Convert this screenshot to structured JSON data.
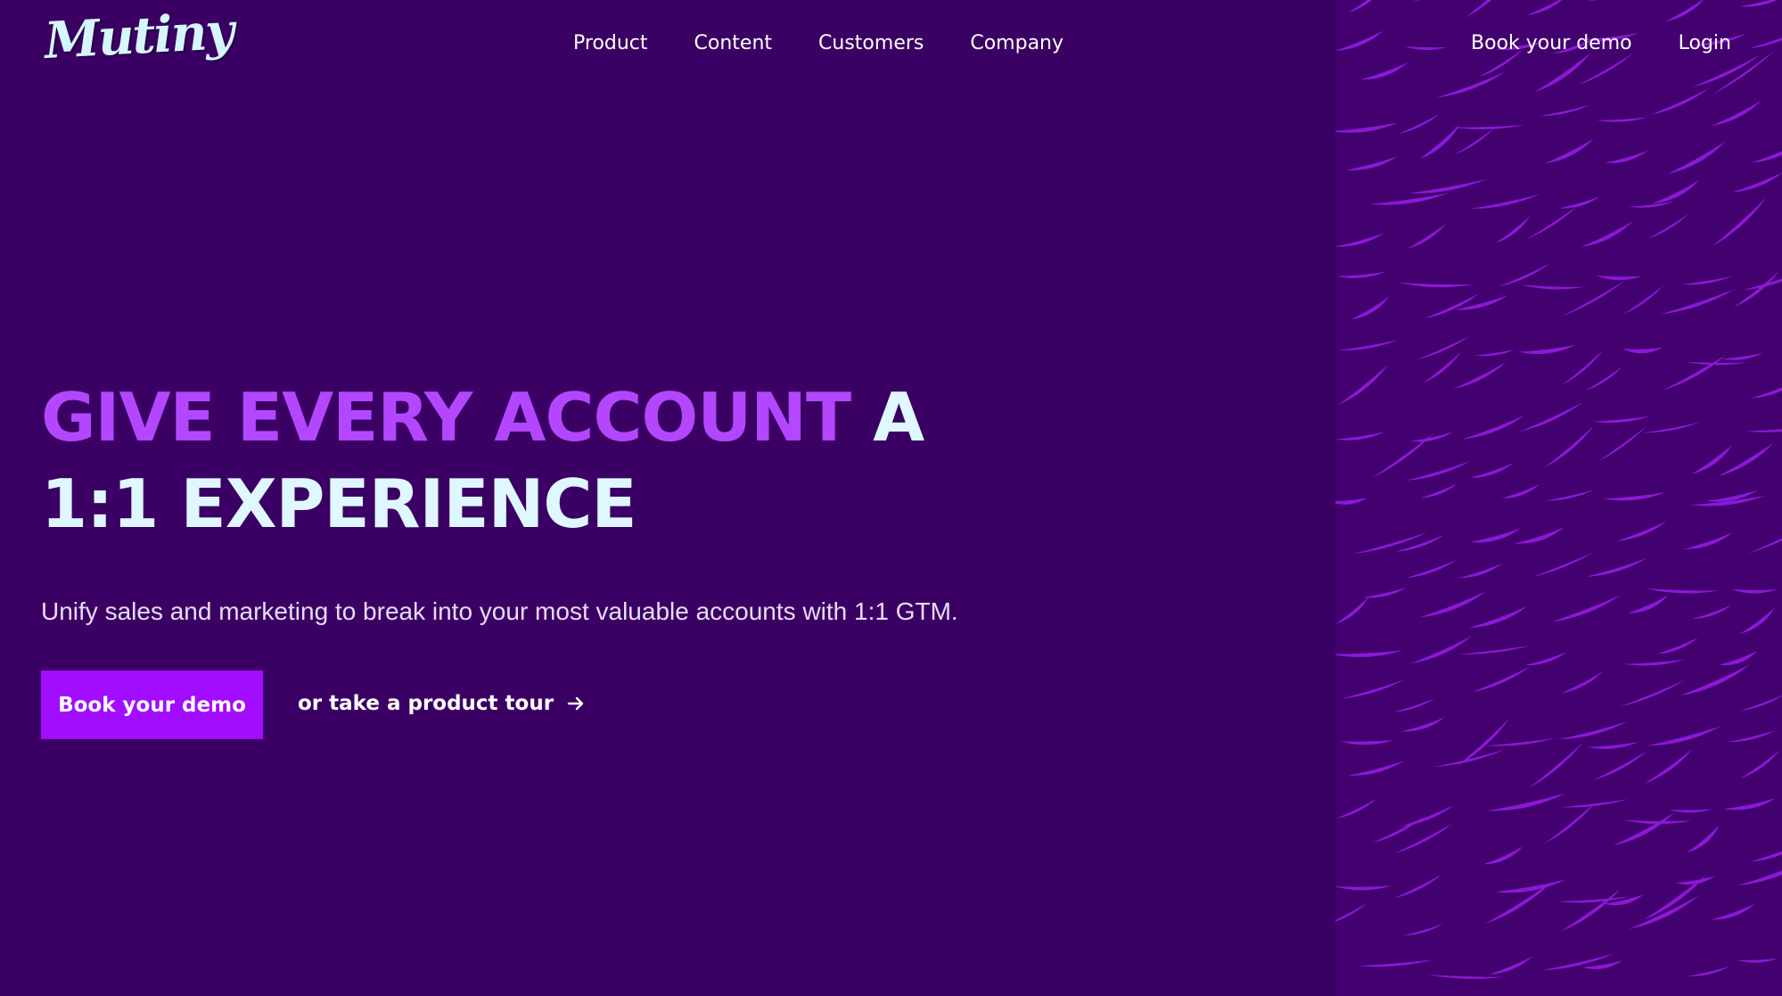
{
  "brand": {
    "logo_text": "Mutiny"
  },
  "nav": {
    "items": [
      {
        "label": "Product"
      },
      {
        "label": "Content"
      },
      {
        "label": "Customers"
      },
      {
        "label": "Company"
      }
    ],
    "book_demo_label": "Book your demo",
    "login_label": "Login"
  },
  "hero": {
    "title_accent": "GIVE EVERY ACCOUNT",
    "title_light": "A 1:1 EXPERIENCE",
    "subtitle": "Unify sales and marketing to break into your most valuable accounts with 1:1 GTM.",
    "primary_cta": "Book your demo",
    "secondary_cta": "or take a product tour",
    "secondary_cta_icon": "arrow-right-icon"
  },
  "colors": {
    "background": "#3b0063",
    "accent_purple": "#b347ff",
    "light_text": "#dff7ff",
    "button_purple": "#a20cff",
    "pattern_background": "#43006f",
    "pattern_stroke": "#8a18d6"
  }
}
